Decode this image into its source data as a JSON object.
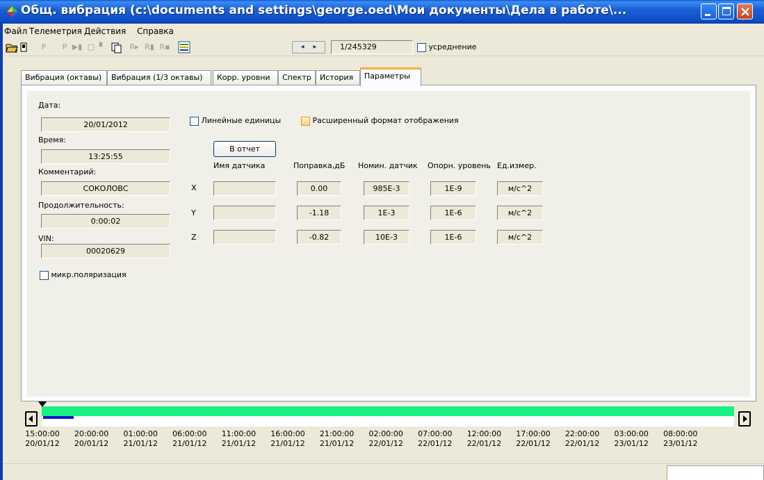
{
  "window": {
    "title": "Общ. вибрация (c:\\documents and settings\\george.oed\\Мои документы\\Дела в работе\\..."
  },
  "menu": [
    "Файл",
    "Телеметрия",
    "Действия",
    "Справка"
  ],
  "toolbar": {
    "counter": "1/245329",
    "averaging_label": "усреднение",
    "averaging_checked": false
  },
  "tabs": [
    {
      "label": "Вибрация (октавы)",
      "active": false
    },
    {
      "label": "Вибрация (1/3 октавы)",
      "active": false
    },
    {
      "label": "Корр. уровни",
      "active": false
    },
    {
      "label": "Спектр",
      "active": false
    },
    {
      "label": "История",
      "active": false
    },
    {
      "label": "Параметры",
      "active": true
    }
  ],
  "params": {
    "date_label": "Дата:",
    "date_value": "20/01/2012",
    "time_label": "Время:",
    "time_value": "13:25:55",
    "comment_label": "Комментарий:",
    "comment_value": "СОКОЛОВС",
    "duration_label": "Продолжительность:",
    "duration_value": "0:00:02",
    "vin_label": "VIN:",
    "vin_value": "00020629",
    "mic_polarization_label": "микр.поляризация",
    "mic_polarization_checked": false,
    "linear_units_label": "Линейные единицы",
    "linear_units_checked": false,
    "extended_format_label": "Расширенный формат отображения",
    "extended_format_checked": false,
    "report_button": "В отчет"
  },
  "sensor_table": {
    "headers": [
      "Имя датчика",
      "Поправка,дБ",
      "Номин. датчик",
      "Опорн. уровень",
      "Ед.измер."
    ],
    "rows": [
      {
        "axis": "X",
        "name": "",
        "correction": "0.00",
        "nominal": "985E-3",
        "reference": "1E-9",
        "unit": "м/с^2"
      },
      {
        "axis": "Y",
        "name": "",
        "correction": "-1.18",
        "nominal": "1E-3",
        "reference": "1E-6",
        "unit": "м/с^2"
      },
      {
        "axis": "Z",
        "name": "",
        "correction": "-0.82",
        "nominal": "10E-3",
        "reference": "1E-6",
        "unit": "м/с^2"
      }
    ]
  },
  "timeline": {
    "labels": [
      {
        "time": "15:00:00",
        "date": "20/01/12"
      },
      {
        "time": "20:00:00",
        "date": "20/01/12"
      },
      {
        "time": "01:00:00",
        "date": "21/01/12"
      },
      {
        "time": "06:00:00",
        "date": "21/01/12"
      },
      {
        "time": "11:00:00",
        "date": "21/01/12"
      },
      {
        "time": "16:00:00",
        "date": "21/01/12"
      },
      {
        "time": "21:00:00",
        "date": "21/01/12"
      },
      {
        "time": "02:00:00",
        "date": "22/01/12"
      },
      {
        "time": "07:00:00",
        "date": "22/01/12"
      },
      {
        "time": "12:00:00",
        "date": "22/01/12"
      },
      {
        "time": "17:00:00",
        "date": "22/01/12"
      },
      {
        "time": "22:00:00",
        "date": "22/01/12"
      },
      {
        "time": "03:00:00",
        "date": "23/01/12"
      },
      {
        "time": "08:00:00",
        "date": "23/01/12"
      }
    ],
    "colors": {
      "range": "#19f184",
      "selection": "#1414d2"
    }
  }
}
